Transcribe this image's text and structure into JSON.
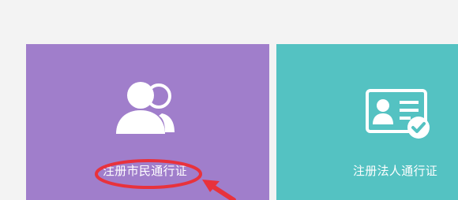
{
  "cards": [
    {
      "label": "注册市民通行证",
      "color": "#a07ecb",
      "icon": "users-icon"
    },
    {
      "label": "注册法人通行证",
      "color": "#54c2c2",
      "icon": "id-card-icon"
    }
  ],
  "annotation": {
    "color": "#e8323c",
    "shapes": [
      "ellipse-highlight",
      "pointer-arrow"
    ]
  }
}
